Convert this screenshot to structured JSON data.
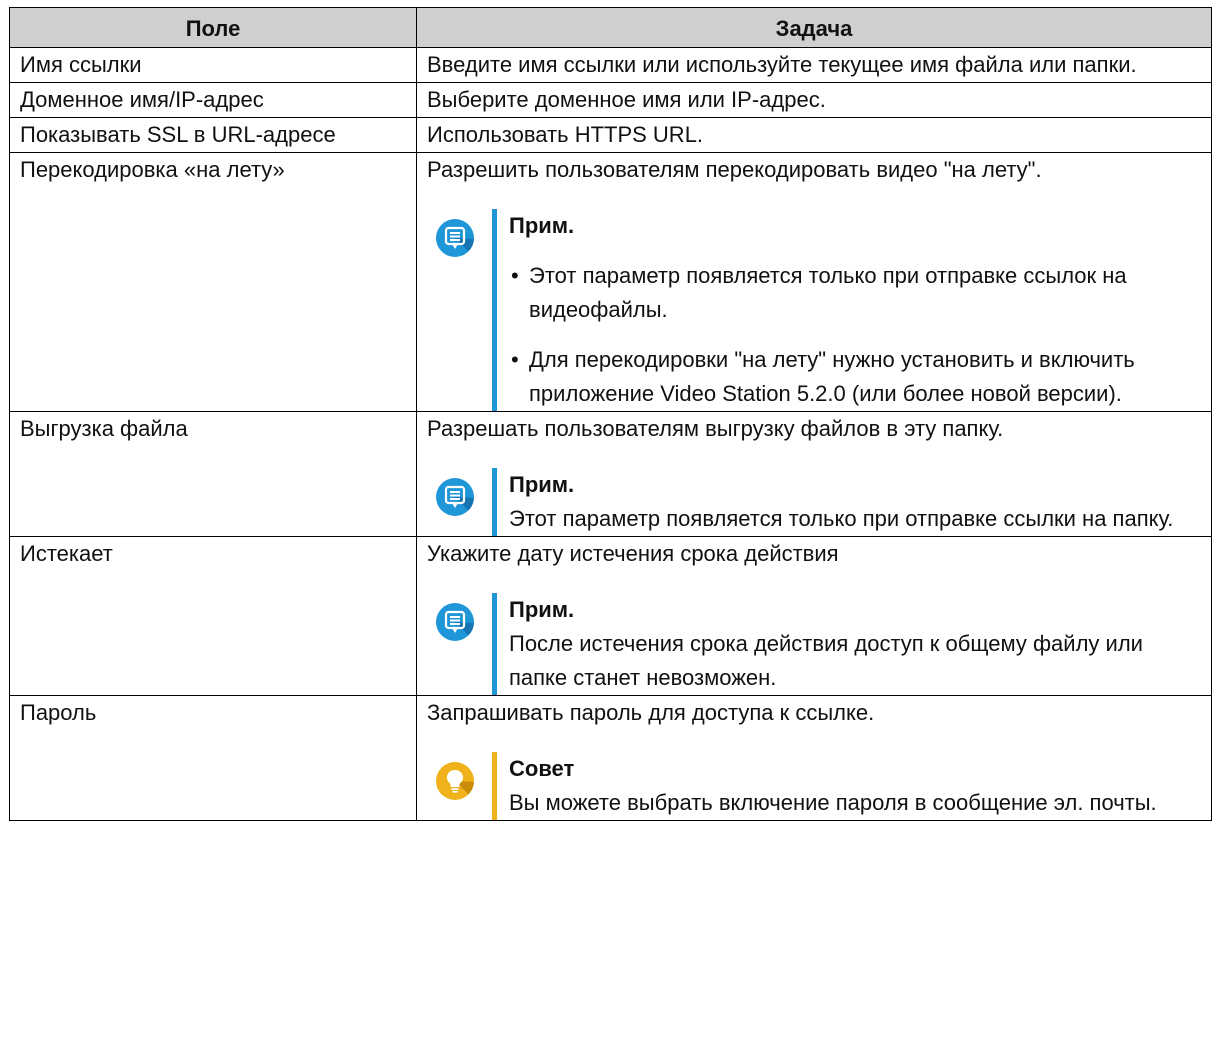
{
  "table": {
    "headers": {
      "field": "Поле",
      "task": "Задача"
    },
    "rows": [
      {
        "field": "Имя ссылки",
        "task": "Введите имя ссылки или используйте текущее имя файла или папки."
      },
      {
        "field": "Доменное имя/IP-адрес",
        "task": "Выберите доменное имя или IP-адрес."
      },
      {
        "field": "Показывать SSL в URL-адресе",
        "task": "Использовать HTTPS URL."
      },
      {
        "field": "Перекодировка «на лету»",
        "task": "Разрешить пользователям перекодировать видео \"на лету\".",
        "note": {
          "kind": "note",
          "icon": "note-icon",
          "label": "Прим.",
          "items": [
            "Этот параметр появляется только при отправке ссылок на видеофайлы.",
            "Для перекодировки \"на лету\" нужно установить и включить приложение Video Station 5.2.0 (или более новой версии)."
          ]
        }
      },
      {
        "field": "Выгрузка файла",
        "task": "Разрешать пользователям выгрузку файлов в эту папку.",
        "note": {
          "kind": "note",
          "icon": "note-icon",
          "label": "Прим.",
          "text": "Этот параметр появляется только при отправке ссылки на папку."
        }
      },
      {
        "field": "Истекает",
        "task": "Укажите дату истечения срока действия",
        "note": {
          "kind": "note",
          "icon": "note-icon",
          "label": "Прим.",
          "text": "После истечения срока действия доступ к общему файлу или папке станет невозможен."
        }
      },
      {
        "field": "Пароль",
        "task": "Запрашивать пароль для доступа к ссылке.",
        "note": {
          "kind": "tip",
          "icon": "lightbulb-icon",
          "label": "Совет",
          "text": "Вы можете выбрать включение пароля в сообщение эл. почты."
        }
      }
    ]
  },
  "colors": {
    "header_bg": "#cfcfcf",
    "note_accent": "#1e96d8",
    "tip_accent": "#f0b21b",
    "border": "#000000"
  }
}
